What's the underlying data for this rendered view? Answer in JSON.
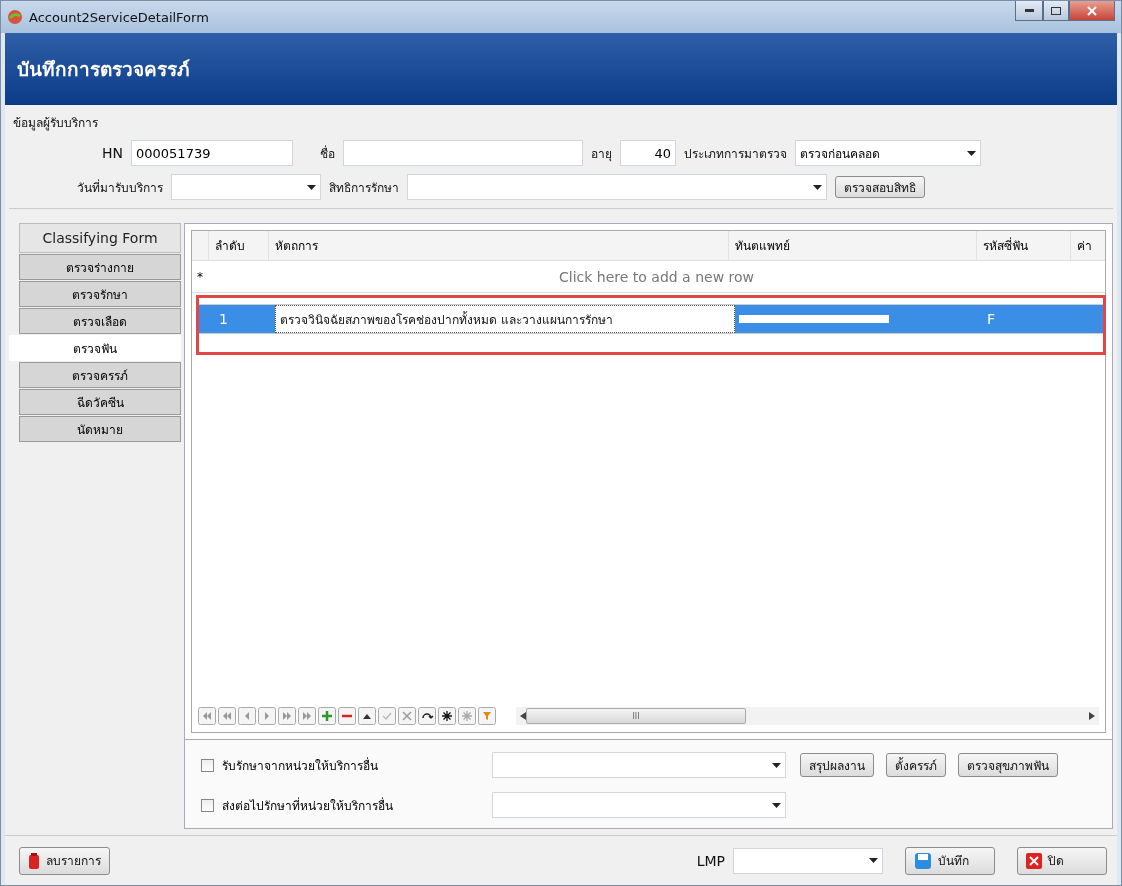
{
  "window": {
    "title": "Account2ServiceDetailForm"
  },
  "header": {
    "title": "บันทึกการตรวจครรภ์"
  },
  "patient": {
    "group_label": "ข้อมูลผู้รับบริการ",
    "hn_label": "HN",
    "hn": "000051739",
    "name_label": "ชื่อ",
    "age_label": "อายุ",
    "age": "40",
    "visit_type_label": "ประเภทการมาตรวจ",
    "visit_type": "ตรวจก่อนคลอด",
    "service_date_label": "วันที่มารับบริการ",
    "right_label": "สิทธิการรักษา",
    "check_right_button": "ตรวจสอบสิทธิ"
  },
  "sidebar": {
    "header": "Classifying Form",
    "items": [
      {
        "label": "ตรวจร่างกาย",
        "selected": false
      },
      {
        "label": "ตรวจรักษา",
        "selected": false
      },
      {
        "label": "ตรวจเลือด",
        "selected": false
      },
      {
        "label": "ตรวจฟัน",
        "selected": true
      },
      {
        "label": "ตรวจครรภ์",
        "selected": false
      },
      {
        "label": "ฉีดวัคซีน",
        "selected": false
      },
      {
        "label": "นัดหมาย",
        "selected": false
      }
    ]
  },
  "grid": {
    "columns": [
      "ลำดับ",
      "หัตถการ",
      "ทันตแพทย์",
      "รหัสซี่ฟัน",
      "ค่า"
    ],
    "new_row_marker": "*",
    "new_row_hint": "Click here to add a new row",
    "rows": [
      {
        "order": "1",
        "procedure": "ตรวจวินิจฉัยสภาพของโรคช่องปากทั้งหมด และวางแผนการรักษา",
        "tooth_code": "F",
        "selected": true
      }
    ],
    "scroll_grip": "III"
  },
  "options": [
    {
      "label": "รับรักษาจากหน่วยให้บริการอื่น",
      "checked": false
    },
    {
      "label": "ส่งต่อไปรักษาที่หน่วยให้บริการอื่น",
      "checked": false
    }
  ],
  "action_buttons": [
    "สรุปผลงาน",
    "ตั้งครรภ์",
    "ตรวจสุขภาพฟัน"
  ],
  "footer": {
    "delete_button": "ลบรายการ",
    "lmp_label": "LMP",
    "save_button": "บันทึก",
    "close_button": "ปิด"
  }
}
